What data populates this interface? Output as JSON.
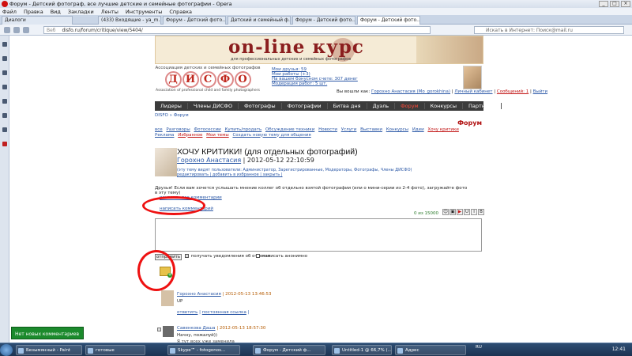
{
  "browser": {
    "title": "Форум - Детский фотограф, все лучшие детские и семейные фотографии - Opera",
    "menu": [
      "Файл",
      "Правка",
      "Вид",
      "Закладки",
      "Ленты",
      "Инструменты",
      "Справка"
    ],
    "tabs": [
      "Диалоги",
      "(433) Входящие - ya_m...",
      "Форум - Детский фото...",
      "Детский и семейный ф...",
      "Форум - Детский фото...",
      "Форум - Детский фото..."
    ],
    "address_prefix": "Веб",
    "address": "disfo.ru/forum/critique/view/5404/",
    "search_placeholder": "Искать в Интернет: Поиск@mail.ru"
  },
  "site": {
    "banner": {
      "title": "on-line курс",
      "subtitle": "для профессиональных детских и семейных фотографов"
    },
    "logo": {
      "assoc_ru": "Ассоциация детских и семейных фотографов",
      "letters": [
        "Д",
        "И",
        "С",
        "Ф",
        "О"
      ],
      "assoc_en": "Association of professional child and family photographers"
    },
    "user_links": [
      "Мои друзья: 59",
      "Мои работы (+3)",
      "На вашем бонусном счете: 307 денег",
      "Модерация работ: 5 шт."
    ],
    "greeting": {
      "prefix": "Вы вошли как:",
      "user": "Горохно Анастасия (Mo_gorokhina)",
      "cabinet": "Личный кабинет",
      "messages": "Сообщений: 1",
      "exit": "Выйти"
    },
    "nav": [
      "Лидеры",
      "Члены ДИСФО",
      "Фотографы",
      "Фотографии",
      "Битва дня",
      "Дуэль",
      "Форум",
      "Конкурсы",
      "Партнеры"
    ],
    "breadcrumb": "DISFO » Форум",
    "forum_title": "Форум",
    "categories": [
      "все",
      "Разговоры",
      "Фотосессии",
      "Купить/продать",
      "Обсуждение техники",
      "Новости",
      "Услуги",
      "Выставки",
      "Конкурсы",
      "Идеи",
      "Хочу критики",
      "Реклама",
      "Избранное",
      "Мои темы",
      "Создать новую тему для общения"
    ],
    "topic": {
      "title": "ХОЧУ КРИТИКИ! (для отдельных фотографий)",
      "author": "Горохно Анастасия",
      "date": "| 2012-05-12 22:10:59",
      "visibility": "(эту тему видят пользователи: Администратор, Зарегистрированные, Модераторы, Фотографы, Члены ДИСФО)",
      "actions": "редактировать | добавить в избранное | закрыть |",
      "description": "Друзья! Если вам хочется услышать мнение коллег об отдельно взятой фотографии (или о мини-серии из 2-4 фото), загружайте фото в эту тему)",
      "show_all": "показать все комментарии",
      "write_comment": "написать комментарий"
    },
    "editor": {
      "counter": "0 из 15000",
      "tools": [
        "☺",
        "▣",
        "▶",
        "U",
        "I",
        "B"
      ],
      "send": "отправить",
      "notify": "получать уведомления об ответах",
      "anonymous": "написать анонимно"
    },
    "comments": [
      {
        "author": "Горохно Анастасия",
        "date": "| 2012-05-13 13:46:53",
        "text": "UP",
        "links": [
          "ответить",
          "постоянная ссылка"
        ]
      },
      {
        "author": "Савенкова Даша",
        "date": "| 2012-05-13 18:57:30",
        "text": "Начну, пожалуй))",
        "sub": "Я тут всех уже заменила"
      }
    ],
    "notification": "Нет новых комментариев"
  },
  "taskbar": {
    "items": [
      "Безымянный - Paint",
      "готовые",
      "Skype™ - fotogonos...",
      "Форум - Детский ф...",
      "Untitled-1 @ 66,7% (...",
      "Адрес"
    ],
    "tray": "RU",
    "clock": "12:41"
  }
}
